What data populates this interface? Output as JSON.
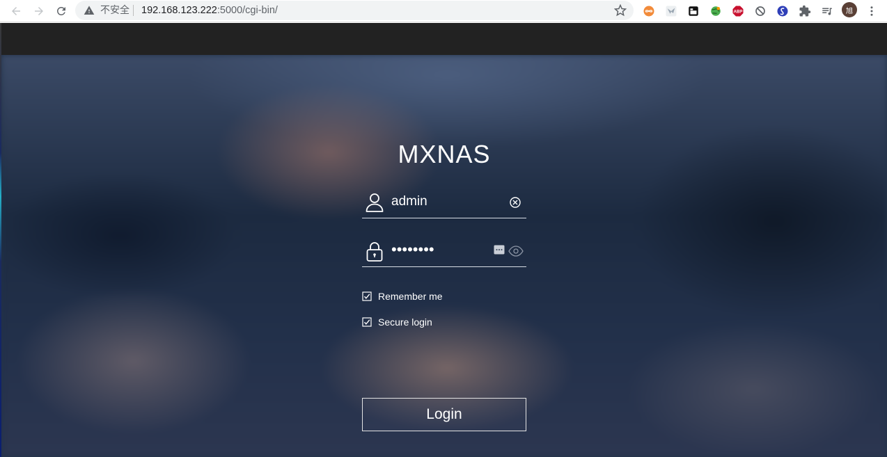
{
  "browser": {
    "security_label": "不安全",
    "url_host": "192.168.123.222",
    "url_rest": ":5000/cgi-bin/",
    "profile_initial": "旭",
    "icons": {
      "back": "back-arrow-icon",
      "forward": "forward-arrow-icon",
      "reload": "reload-icon",
      "warning": "warning-icon",
      "bookmark": "star-icon",
      "extensions": [
        "infinity-extension-icon",
        "bird-extension-icon",
        "tab-extension-icon",
        "globe-extension-icon",
        "adblock-extension-icon",
        "block-extension-icon",
        "s-extension-icon",
        "puzzle-icon",
        "playlist-icon",
        "more-icon"
      ]
    }
  },
  "login": {
    "title": "MXNAS",
    "username": "admin",
    "password_masked": "••••••••",
    "remember_label": "Remember me",
    "remember_checked": true,
    "secure_label": "Secure login",
    "secure_checked": true,
    "button_label": "Login"
  },
  "colors": {
    "top_strip": "#222222",
    "text": "#ffffff",
    "adblock": "#c8102e",
    "avatar": "#5a4036"
  }
}
